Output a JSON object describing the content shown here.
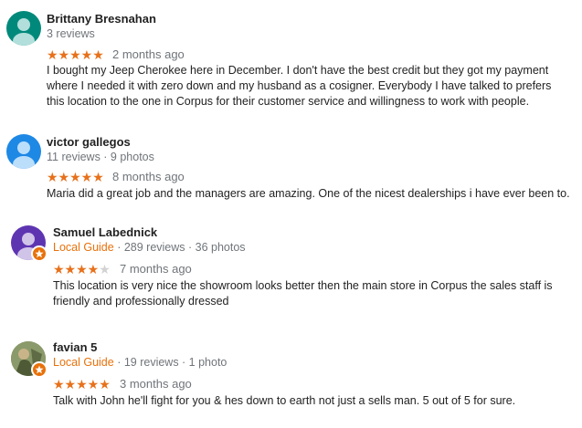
{
  "reviews": [
    {
      "name": "Brittany Bresnahan",
      "meta": "3 reviews",
      "local_guide": "",
      "rating": 5,
      "time": "2 months ago",
      "text": "I bought my Jeep Cherokee here in December. I don't have the best credit but they got my payment where I needed it with zero down and my husband as a cosigner. Everybody I have talked to prefers this location to the one in Corpus for their customer service and willingness to work with people.",
      "avatar_color": "#00897b"
    },
    {
      "name": "victor gallegos",
      "meta": "11 reviews · 9 photos",
      "local_guide": "",
      "rating": 5,
      "time": "8 months ago",
      "text": "Maria did a great job and the managers are amazing. One of the nicest dealerships i have ever been to.",
      "avatar_color": "#1e88e5"
    },
    {
      "name": "Samuel Labednick",
      "meta": " · 289 reviews · 36 photos",
      "local_guide": "Local Guide",
      "rating": 4,
      "time": "7 months ago",
      "text": "This location is very nice the showroom looks better then the main store in Corpus the sales staff is friendly and professionally dressed",
      "avatar_color": "#5e35b1"
    },
    {
      "name": "favian 5",
      "meta": " · 19 reviews · 1 photo",
      "local_guide": "Local Guide",
      "rating": 5,
      "time": "3 months ago",
      "text": "Talk with John he'll fight for you & hes down to earth not just a sells man. 5 out of 5 for sure.",
      "avatar_color": "#6d7a4f"
    }
  ],
  "colors": {
    "star": "#e7711b",
    "local_guide": "#e8710a",
    "meta": "#70757a"
  }
}
